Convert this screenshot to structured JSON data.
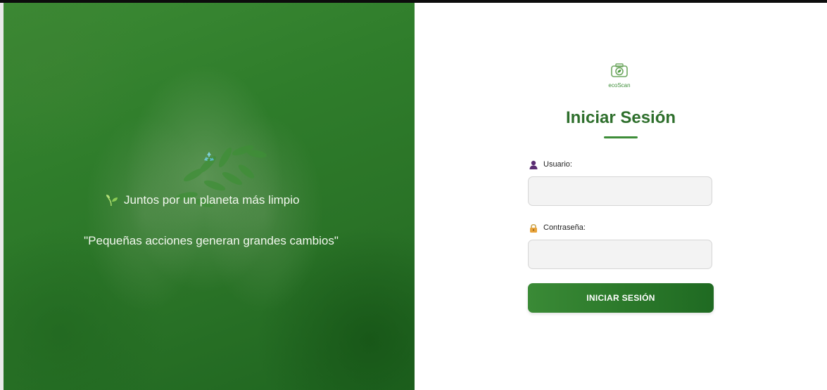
{
  "hero": {
    "tagline": "Juntos por un planeta más limpio",
    "quote": "\"Pequeñas acciones generan grandes cambios\"",
    "icons": {
      "recycle": "recycle-icon",
      "sprout": "sprout-icon"
    }
  },
  "brand": {
    "logo_text": "ecoScan",
    "logo_icon": "camera-leaf-icon"
  },
  "login": {
    "title": "Iniciar Sesión",
    "username_label": "Usuario:",
    "username_value": "",
    "username_icon": "user-icon",
    "password_label": "Contraseña:",
    "password_value": "",
    "password_icon": "lock-icon",
    "submit_label": "INICIAR SESIÓN"
  },
  "colors": {
    "brand_green": "#2e6f2c",
    "button_green": "#2c7a2b",
    "hero_green": "#2f7d2b"
  }
}
